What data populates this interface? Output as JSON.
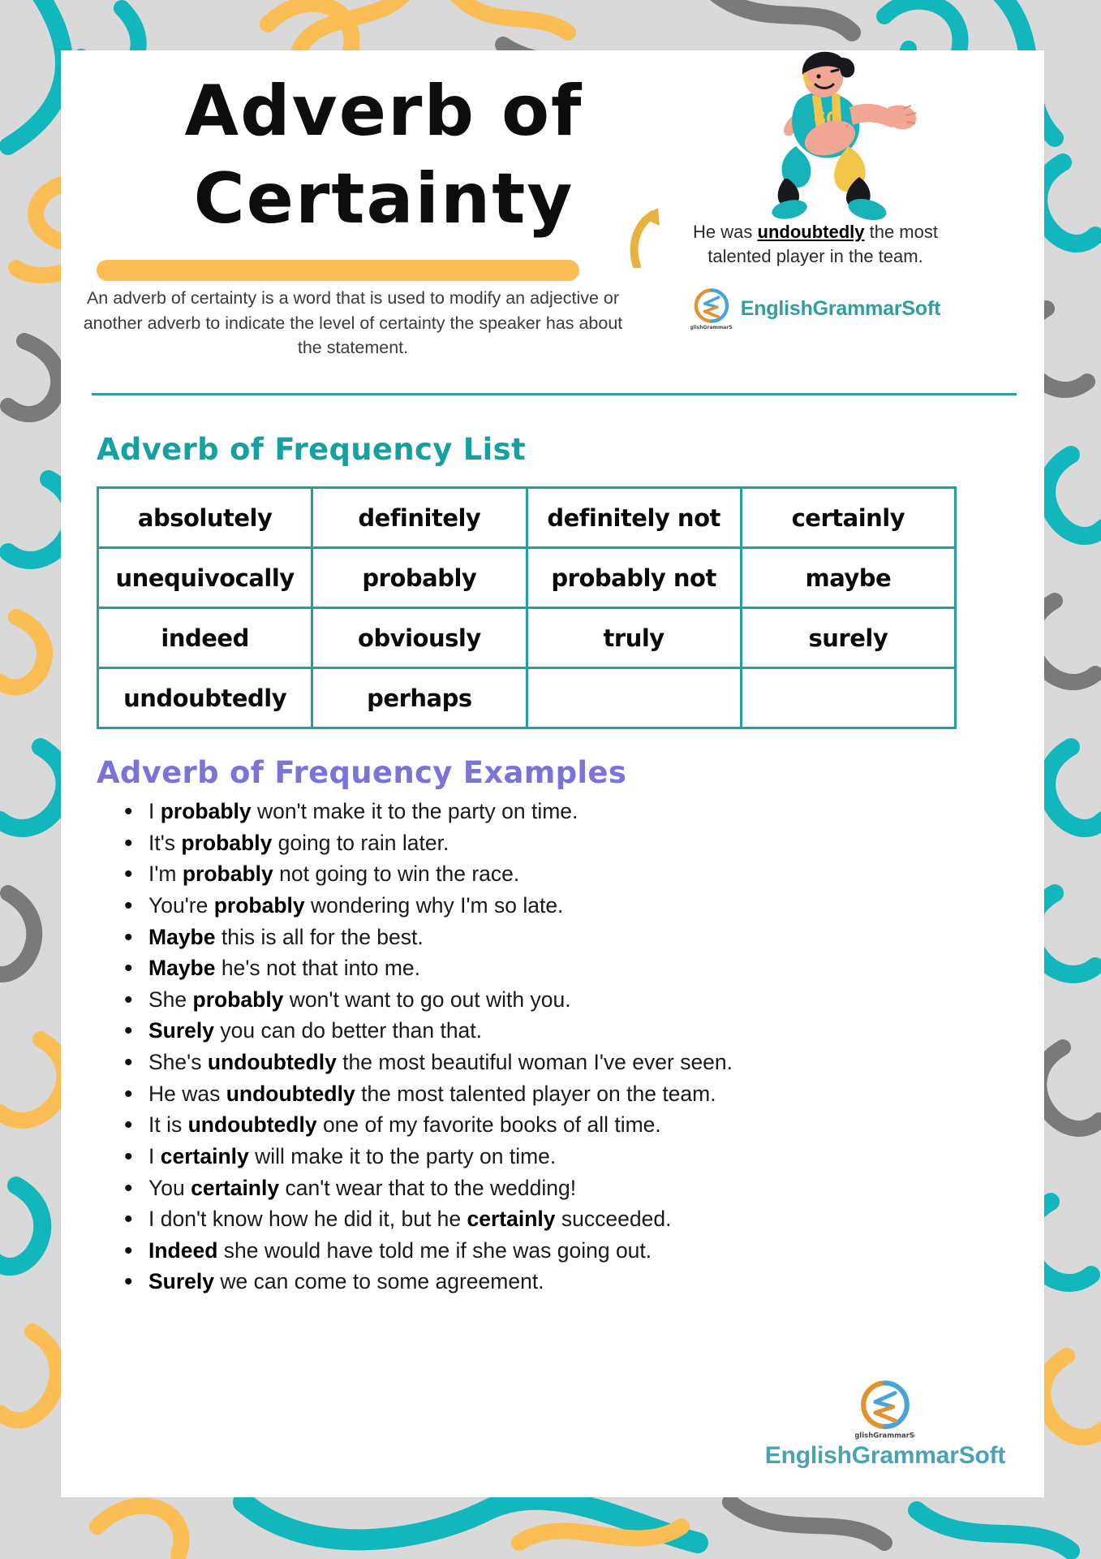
{
  "header": {
    "title_line1": "Adverb of",
    "title_line2": "Certainty",
    "description": "An adverb of certainty is a word that is used to modify an adjective or another adverb to indicate the level of certainty the speaker has about the statement.",
    "caption_pre": "He was ",
    "caption_bold": "undoubtedly",
    "caption_post": " the most talented player in the team.",
    "brand": "EnglishGrammarSoft",
    "brand_mark_small": "EnglishGrammarSoft"
  },
  "list_section": {
    "heading": "Adverb of Frequency List",
    "rows": [
      [
        "absolutely",
        "definitely",
        "definitely not",
        "certainly"
      ],
      [
        "unequivocally",
        "probably",
        "probably not",
        "maybe"
      ],
      [
        "indeed",
        "obviously",
        "truly",
        "surely"
      ],
      [
        "undoubtedly",
        "perhaps",
        "",
        ""
      ]
    ]
  },
  "examples_section": {
    "heading": "Adverb of Frequency Examples",
    "items": [
      {
        "pre": "I ",
        "bold": "probably",
        "post": " won't make it to the party on time."
      },
      {
        "pre": "It's ",
        "bold": "probably",
        "post": " going to rain later."
      },
      {
        "pre": "I'm ",
        "bold": "probably",
        "post": " not going to win the race."
      },
      {
        "pre": "You're ",
        "bold": "probably",
        "post": " wondering why I'm so late."
      },
      {
        "pre": "",
        "bold": "Maybe",
        "post": " this is all for the best."
      },
      {
        "pre": "",
        "bold": "Maybe",
        "post": " he's not that into me."
      },
      {
        "pre": "She ",
        "bold": "probably",
        "post": " won't want to go out with you."
      },
      {
        "pre": "",
        "bold": "Surely",
        "post": " you can do better than that."
      },
      {
        "pre": "She's ",
        "bold": "undoubtedly",
        "post": " the most beautiful woman I've ever seen."
      },
      {
        "pre": "He was ",
        "bold": "undoubtedly",
        "post": " the most talented player on the team."
      },
      {
        "pre": "It is ",
        "bold": "undoubtedly",
        "post": " one of my favorite books of all time."
      },
      {
        "pre": "I ",
        "bold": "certainly",
        "post": " will make it to the party on time."
      },
      {
        "pre": "You ",
        "bold": "certainly",
        "post": " can't wear that to the wedding!"
      },
      {
        "pre": "I don't know how he did it, but he ",
        "bold": "certainly",
        "post": " succeeded."
      },
      {
        "pre": "",
        "bold": "Indeed",
        "post": " she would have told me if she was going out."
      },
      {
        "pre": "",
        "bold": "Surely",
        "post": " we can come to some agreement."
      }
    ]
  },
  "footer": {
    "brand": "EnglishGrammarSoft",
    "brand_mark_small": "EnglishGrammarSoft"
  },
  "colors": {
    "teal": "#16a0a0",
    "purple": "#7b73d6",
    "orange": "#fbbe55",
    "grey": "#808080",
    "background": "#d9d9d9",
    "card": "#ffffff",
    "table_border": "#22a0a0",
    "logo_teal": "#2f9ea0",
    "logo_orange": "#e3922f",
    "logo_blue": "#4aa3d8"
  }
}
